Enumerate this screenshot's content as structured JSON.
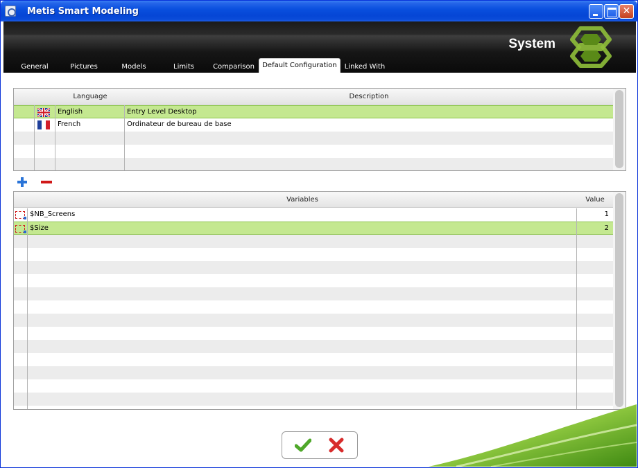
{
  "window": {
    "title": "Metis Smart Modeling"
  },
  "header": {
    "title": "System"
  },
  "tabs": [
    {
      "label": "General"
    },
    {
      "label": "Pictures"
    },
    {
      "label": "Models"
    },
    {
      "label": "Limits"
    },
    {
      "label": "Comparison"
    },
    {
      "label": "Default Configuration",
      "active": true
    },
    {
      "label": "Linked With"
    }
  ],
  "language_grid": {
    "columns": {
      "language": "Language",
      "description": "Description"
    },
    "rows": [
      {
        "language": "English",
        "description": "Entry Level Desktop",
        "flag": "uk-flag-icon",
        "selected": true
      },
      {
        "language": "French",
        "description": "Ordinateur de bureau de base",
        "flag": "french-flag-icon",
        "selected": false
      }
    ]
  },
  "variables_grid": {
    "columns": {
      "variables": "Variables",
      "value": "Value"
    },
    "rows": [
      {
        "name": "$NB_Screens",
        "value": "1",
        "selected": false
      },
      {
        "name": "$Size",
        "value": "2",
        "selected": true
      }
    ]
  },
  "toolbar": {
    "add_icon": "plus-icon",
    "remove_icon": "minus-icon"
  },
  "actions": {
    "ok_icon": "checkmark-icon",
    "cancel_icon": "red-x-icon"
  },
  "colors": {
    "title_bar": "#0a50df",
    "selection": "#c4e890",
    "accent_green": "#7ab82a"
  }
}
